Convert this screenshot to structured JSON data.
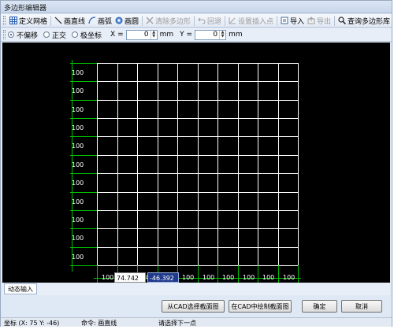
{
  "window": {
    "title": "多边形编辑器"
  },
  "toolbar": {
    "items": [
      {
        "label": "定义网格",
        "icon": "grid-icon",
        "enabled": true
      },
      {
        "label": "画直线",
        "icon": "line-icon",
        "enabled": true
      },
      {
        "label": "画弧",
        "icon": "arc-icon",
        "enabled": true
      },
      {
        "label": "画圆",
        "icon": "circle-icon",
        "enabled": true
      },
      {
        "label": "清除多边形",
        "icon": "clear-icon",
        "enabled": false
      },
      {
        "label": "回退",
        "icon": "undo-icon",
        "enabled": false
      },
      {
        "label": "设置插入点",
        "icon": "insert-point-icon",
        "enabled": false
      },
      {
        "label": "导入",
        "icon": "import-icon",
        "enabled": true
      },
      {
        "label": "导出",
        "icon": "export-icon",
        "enabled": false
      },
      {
        "label": "查询多边形库",
        "icon": "search-icon",
        "enabled": true
      }
    ]
  },
  "options": {
    "modes": [
      {
        "label": "不偏移",
        "selected": true
      },
      {
        "label": "正交",
        "selected": false
      },
      {
        "label": "极坐标",
        "selected": false
      }
    ],
    "x_label": "X =",
    "x_value": "0",
    "y_label": "Y =",
    "y_value": "0",
    "unit": "mm"
  },
  "canvas": {
    "row_labels": [
      "100",
      "100",
      "100",
      "100",
      "100",
      "100",
      "100",
      "100",
      "100",
      "100",
      "100"
    ],
    "col_labels": [
      "100",
      "100",
      "100",
      "100",
      "100",
      "100",
      "100",
      "100",
      "100",
      "100"
    ],
    "dynamic_x": "74.742",
    "dynamic_y": "-46.392",
    "grid_color": "#ffffff",
    "dim_color": "#00c000",
    "background": "#000000"
  },
  "tabs": {
    "dynamic_input": "动态输入"
  },
  "buttons": {
    "select_from_cad": "从CAD选择截面图",
    "draw_in_cad": "在CAD中绘制截面图",
    "ok": "确定",
    "cancel": "取消"
  },
  "status": {
    "coords": "坐标 (X: 75 Y: -46)",
    "command": "命令: 画直线",
    "prompt": "请选择下一点"
  }
}
